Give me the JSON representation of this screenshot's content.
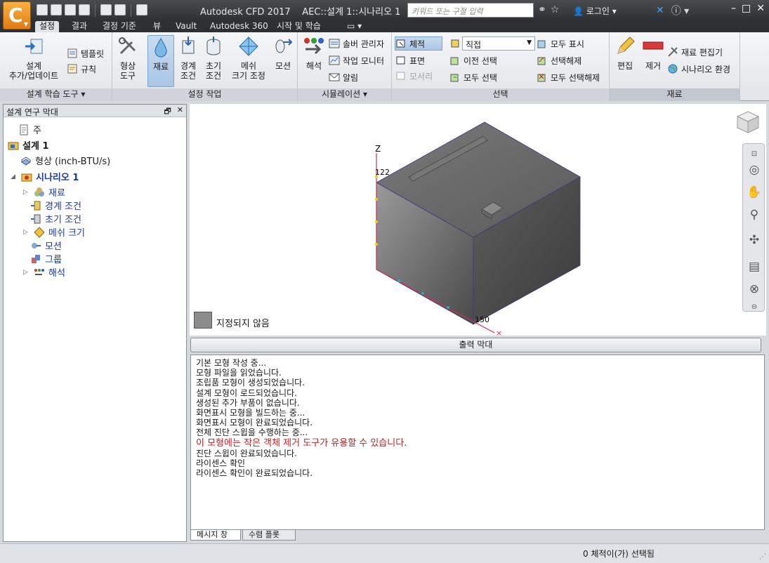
{
  "app": {
    "title": "Autodesk CFD 2017",
    "document_title": "AEC::설계 1::시나리오 1",
    "search_placeholder": "키워드 또는 구절 입력",
    "login": "로그인"
  },
  "tabs": [
    "설정",
    "결과",
    "결정 기준",
    "뷰",
    "Vault",
    "Autodesk 360",
    "시작 및 학습"
  ],
  "active_tab": "설정",
  "ribbon": {
    "design_study_tools": {
      "label": "설계 학습 도구",
      "add_update_1": "설계",
      "add_update_2": "추가/업데이트",
      "template": "템플릿",
      "rules": "규칙"
    },
    "setup_tasks": {
      "label": "설정 작업",
      "geometry_tools_1": "형상",
      "geometry_tools_2": "도구",
      "materials": "재료",
      "boundary_1": "경계",
      "boundary_2": "조건",
      "initial_1": "초기",
      "initial_2": "조건",
      "mesh_1": "메쉬",
      "mesh_2": "크기 조정",
      "motion": "모션"
    },
    "simulation": {
      "label": "시뮬레이션",
      "solve": "해석",
      "solver_manager": "솔버 관리자",
      "job_monitor": "작업 모니터",
      "notify": "알림"
    },
    "selection": {
      "label": "선택",
      "volume": "체적",
      "surface": "표면",
      "edge": "모서리",
      "mode_value": "직접",
      "previous": "이전 선택",
      "select_all": "모두 선택",
      "show_all": "모두 표시",
      "deselect": "선택해제",
      "deselect_all": "모두 선택해제"
    },
    "materials_group": {
      "label": "재료",
      "edit": "편집",
      "remove": "제거",
      "material_editor": "재료 편집기",
      "scenario_env": "시나리오 환경"
    }
  },
  "browser": {
    "title": "설계 연구 막대",
    "items": [
      {
        "label": "주"
      },
      {
        "label": "설계 1"
      },
      {
        "label": "형상 (inch-BTU/s)"
      },
      {
        "label": "시나리오 1"
      },
      {
        "label": "재료"
      },
      {
        "label": "경계 조건"
      },
      {
        "label": "초기 조건"
      },
      {
        "label": "메쉬 크기"
      },
      {
        "label": "모션"
      },
      {
        "label": "그룹"
      },
      {
        "label": "해석"
      }
    ]
  },
  "viewport": {
    "axis_z": "Z",
    "axis_top_value": "122",
    "axis_x_value": "150",
    "legend_label": "지정되지 않음",
    "model_color": "#8c8c8c"
  },
  "output": {
    "title": "출력 막대",
    "messages": [
      "기본 모형 작성 중...",
      "모형 파일을 읽었습니다.",
      "조립품 모형이 생성되었습니다.",
      "설계 모형이 로드되었습니다.",
      "생성된 추가 부품이 없습니다.",
      "화면표시 모형을 빌드하는 중...",
      "화면표시 모형이 완료되었습니다.",
      "전체 진단 스윕을 수행하는 중...",
      "이 모형에는 작은 객체 제거 도구가 유용할 수 있습니다.",
      "진단 스윕이 완료되었습니다.",
      "라이센스 확인",
      "라이센스 확인이 완료되었습니다."
    ],
    "warn_color": "#c02020",
    "tabs": [
      "메시지 창",
      "수렴 플롯"
    ]
  },
  "status": {
    "text": "0 체적이(가) 선택됨"
  }
}
